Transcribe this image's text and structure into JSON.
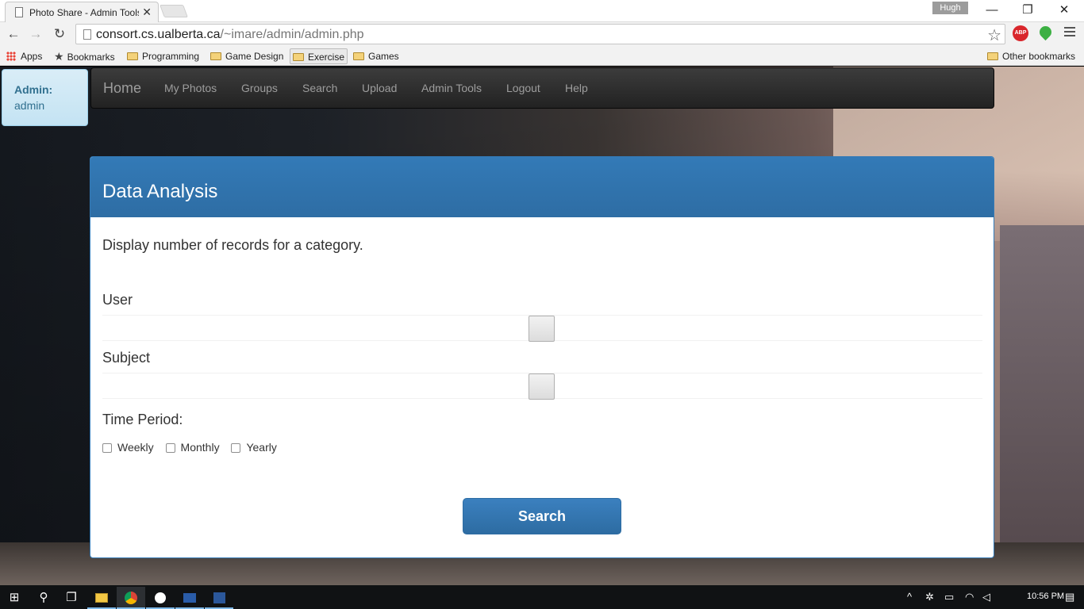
{
  "browser": {
    "tab_title": "Photo Share - Admin Tools",
    "tab_close": "✕",
    "profile_name": "Hugh",
    "window_controls": {
      "minimize": "—",
      "restore": "❐",
      "close": "✕"
    },
    "nav": {
      "back": "←",
      "forward": "→",
      "reload": "↻"
    },
    "url_host": "consort.cs.ualberta.ca",
    "url_path": "/~imare/admin/admin.php",
    "star": "☆",
    "extension_abp": "ABP",
    "bookmarks": [
      {
        "label": "Apps",
        "icon": "apps-icon"
      },
      {
        "label": "Bookmarks",
        "icon": "star-icon"
      },
      {
        "label": "Programming",
        "icon": "folder-icon"
      },
      {
        "label": "Game Design",
        "icon": "folder-icon"
      },
      {
        "label": "Exercise",
        "icon": "folder-icon"
      },
      {
        "label": "Games",
        "icon": "folder-icon"
      }
    ],
    "other_bookmarks": "Other bookmarks"
  },
  "admin_box": {
    "label": "Admin:",
    "name": "admin"
  },
  "navbar": {
    "brand": "Home",
    "links": [
      "My Photos",
      "Groups",
      "Search",
      "Upload",
      "Admin Tools",
      "Logout",
      "Help"
    ]
  },
  "panel": {
    "title": "Data Analysis",
    "description": "Display number of records for a category.",
    "user_label": "User",
    "subject_label": "Subject",
    "time_label": "Time Period:",
    "options": [
      "Weekly",
      "Monthly",
      "Yearly"
    ],
    "search_button": "Search"
  },
  "taskbar": {
    "start": "⊞",
    "search": "⚲",
    "task_view": "❐",
    "apps": [
      "file-explorer",
      "chrome",
      "steam",
      "powershell",
      "word"
    ],
    "clock": "10:56 PM"
  },
  "colors": {
    "panel_primary": "#337ab7",
    "navbar_bg": "#222222",
    "admin_box_bg": "#d9edf7"
  }
}
